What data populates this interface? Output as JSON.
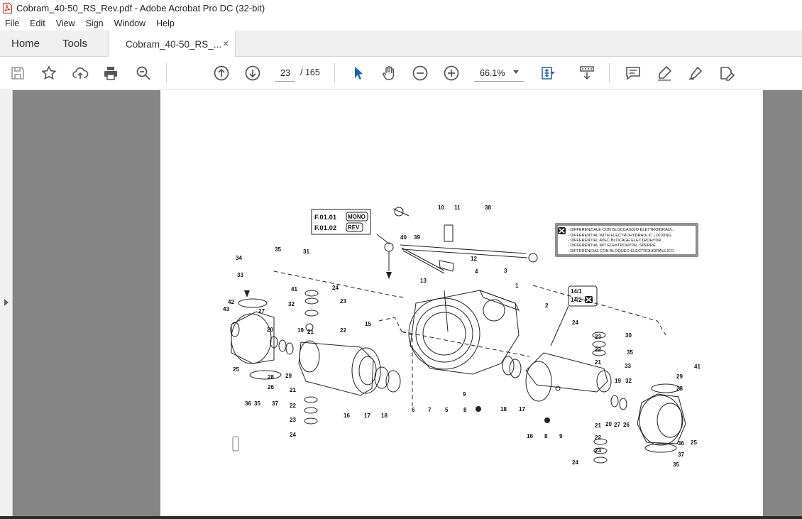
{
  "window": {
    "title": "Cobram_40-50_RS_Rev.pdf - Adobe Acrobat Pro DC (32-bit)"
  },
  "menu": [
    "File",
    "Edit",
    "View",
    "Sign",
    "Window",
    "Help"
  ],
  "tabs": {
    "home": "Home",
    "tools": "Tools",
    "document": "Cobram_40-50_RS_...",
    "close": "×"
  },
  "toolbar": {
    "page_current": "23",
    "page_total": "/ 165",
    "zoom": "66.1%"
  },
  "icons": [
    "save-icon",
    "bookmark-star-icon",
    "upload-cloud-icon",
    "print-icon",
    "zoom-search-icon",
    "page-up-icon",
    "page-down-icon",
    "select-arrow-icon",
    "hand-tool-icon",
    "zoom-out-icon",
    "zoom-in-icon",
    "fit-page-icon",
    "scroll-mode-icon",
    "comment-icon",
    "highlight-icon",
    "draw-icon",
    "fill-sign-icon"
  ],
  "document": {
    "ref_codes": [
      "F.01.01",
      "F.01.02"
    ],
    "ref_tags": [
      "MONO",
      "REV"
    ],
    "diff_legend": [
      "- DIFFERENZIALE CON BLOCCAGGIO ELETTROIDRAUL.",
      "- DIFFERENTIAL WITH ELECTROHYDRAULIC LOCKING",
      "- DIFFERENTIEL AVEC BLOCAGE ELECTROHYDR.",
      "- DIFFERENTIAL MIT ELEKTROHYDR. SPERRE",
      "- DIFFERENCIAL CON BLOQUEO ELECTROHIDRÁULICO"
    ],
    "variant_box": [
      "14/1",
      "14/2"
    ],
    "part_labels": [
      "1",
      "2",
      "3",
      "4",
      "5",
      "6",
      "7",
      "8",
      "8",
      "9",
      "9",
      "10",
      "11",
      "12",
      "13",
      "15",
      "16",
      "16",
      "17",
      "17",
      "18",
      "18",
      "19",
      "19",
      "20",
      "20",
      "21",
      "21",
      "21",
      "21",
      "22",
      "22",
      "22",
      "22",
      "23",
      "23",
      "23",
      "23",
      "24",
      "24",
      "24",
      "24",
      "25",
      "25",
      "26",
      "26",
      "27",
      "27",
      "28",
      "28",
      "29",
      "29",
      "30",
      "31",
      "32",
      "32",
      "33",
      "33",
      "34",
      "35",
      "35",
      "35",
      "35",
      "36",
      "36",
      "37",
      "37",
      "38",
      "39",
      "40",
      "41",
      "41",
      "42",
      "43"
    ]
  }
}
